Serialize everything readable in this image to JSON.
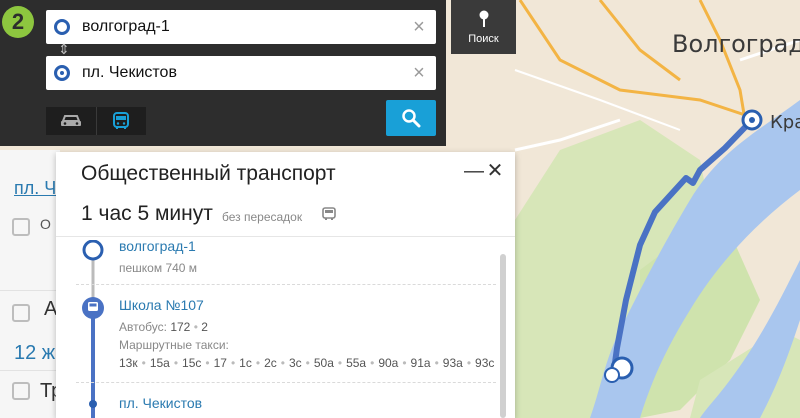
{
  "route": {
    "from": "волгоград-1",
    "to": "пл. Чекистов",
    "search_button": "Поиск"
  },
  "map_labels": {
    "city": "Волгоград",
    "station_partial": "Кра"
  },
  "background_list": {
    "link_partial": "пл. Ч",
    "row_a": "А",
    "row_12": "12 ж",
    "row_tr": "Тр"
  },
  "transit_panel": {
    "title": "Общественный транспорт",
    "duration": "1 час 5 минут",
    "transfers": "без пересадок",
    "stops": [
      {
        "name": "волгоград-1",
        "detail": "пешком 740 м"
      },
      {
        "name": "Школа №107"
      },
      {
        "name": "пл. Чекистов"
      }
    ],
    "bus_label": "Автобус:",
    "bus_routes": [
      "172",
      "2"
    ],
    "taxi_label": "Маршрутные такси:",
    "taxi_routes": [
      "13к",
      "15а",
      "15с",
      "17",
      "1с",
      "2с",
      "3с",
      "50а",
      "55а",
      "90а",
      "91а",
      "93а",
      "93с"
    ]
  },
  "colors": {
    "panel_dark": "#2d2d2d",
    "accent_blue": "#19a0d7",
    "route_line": "#4a72c4",
    "logo_green": "#8dc63f",
    "link_blue": "#2a7ab0"
  }
}
